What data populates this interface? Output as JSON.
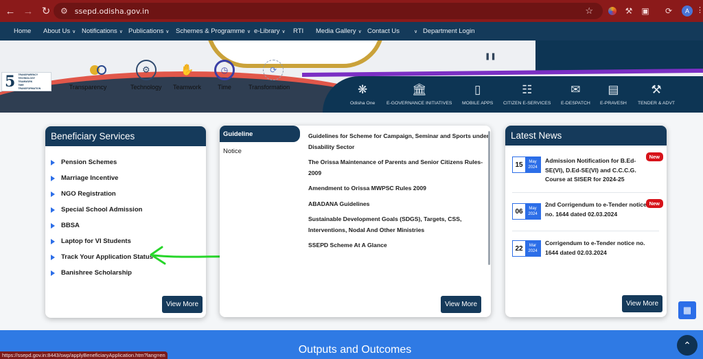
{
  "browser": {
    "url": "ssepd.odisha.gov.in",
    "status_url": "https://ssepd.gov.in:8443/swp/applyBeneficiaryApplication.htm?lang=en",
    "profile_initial": "A",
    "accent_color": "#8b1a1a"
  },
  "nav": {
    "items": [
      {
        "label": "Home",
        "dropdown": false
      },
      {
        "label": "About Us",
        "dropdown": true
      },
      {
        "label": "Notifications",
        "dropdown": true
      },
      {
        "label": "Publications",
        "dropdown": true
      },
      {
        "label": "Schemes & Programme",
        "dropdown": true
      },
      {
        "label": "e-Library",
        "dropdown": true
      },
      {
        "label": "RTI",
        "dropdown": false
      },
      {
        "label": "Media Gallery",
        "dropdown": true
      },
      {
        "label": "Contact Us",
        "dropdown": false
      },
      {
        "label": "",
        "dropdown": true
      },
      {
        "label": "Department Login",
        "dropdown": false
      }
    ]
  },
  "banner": {
    "logo_number": "5",
    "logo_lines": [
      "TRANSPARENCY",
      "TECHNOLOGY",
      "TEAMWORK",
      "TIME",
      "TRANSFORMATION"
    ],
    "pause_icon": "pause-icon",
    "pillars": [
      {
        "label": "Transparency",
        "icon": "transparency-icon"
      },
      {
        "label": "Technology",
        "icon": "technology-icon"
      },
      {
        "label": "Teamwork",
        "icon": "teamwork-icon"
      },
      {
        "label": "Time",
        "icon": "clock-icon"
      },
      {
        "label": "Transformation",
        "icon": "transformation-icon"
      }
    ],
    "services": [
      {
        "label": "Odisha One",
        "icon": "odisha-one-icon"
      },
      {
        "label": "E-GOVERNANCE INITIATIVES",
        "icon": "government-building-icon"
      },
      {
        "label": "MOBILE APPS",
        "icon": "mobile-icon"
      },
      {
        "label": "CITIZEN E-SERVICES",
        "icon": "citizen-services-icon"
      },
      {
        "label": "E-DESPATCH",
        "icon": "mail-icon"
      },
      {
        "label": "E-PRAVESH",
        "icon": "id-card-icon"
      },
      {
        "label": "TENDER & ADVT",
        "icon": "gavel-icon"
      }
    ]
  },
  "beneficiary": {
    "title": "Beneficiary Services",
    "items": [
      "Pension Schemes",
      "Marriage Incentive",
      "NGO Registration",
      "Special School Admission",
      "BBSA",
      "Laptop for VI Students",
      "Track Your Application Status",
      "Banishree Scholarship"
    ],
    "view_more": "View More"
  },
  "guidelines": {
    "tabs": [
      "Guideline",
      "Notice"
    ],
    "active_tab": "Guideline",
    "items": [
      "Guidelines for Scheme for Campaign, Seminar and Sports under Disability Sector",
      "The Orissa Maintenance of Parents and Senior Citizens Rules-2009",
      "Amendment to Orissa MWPSC Rules 2009",
      "ABADANA Guidelines",
      "Sustainable Development Goals (SDGS), Targets, CSS, Interventions, Nodal And Other Ministries",
      "SSEPD Scheme At A Glance"
    ],
    "view_more": "View More"
  },
  "latest_news": {
    "title": "Latest News",
    "items": [
      {
        "day": "15",
        "month": "May",
        "year": "2024",
        "text": "Admission Notification for B.Ed-SE(VI), D.Ed-SE(VI) and C.C.C.G. Course at SISER for 2024-25",
        "badge": "New"
      },
      {
        "day": "06",
        "month": "May",
        "year": "2024",
        "text": "2nd Corrigendum to e-Tender notice no. 1644 dated 02.03.2024",
        "badge": "New"
      },
      {
        "day": "22",
        "month": "Mar",
        "year": "2024",
        "text": "Corrigendum to e-Tender notice no. 1644 dated 02.03.2024",
        "badge": ""
      }
    ],
    "view_more": "View More"
  },
  "outputs": {
    "title": "Outputs and Outcomes"
  },
  "floating": {
    "calendar_icon": "calendar-icon",
    "top_icon": "chevron-up-icon"
  }
}
